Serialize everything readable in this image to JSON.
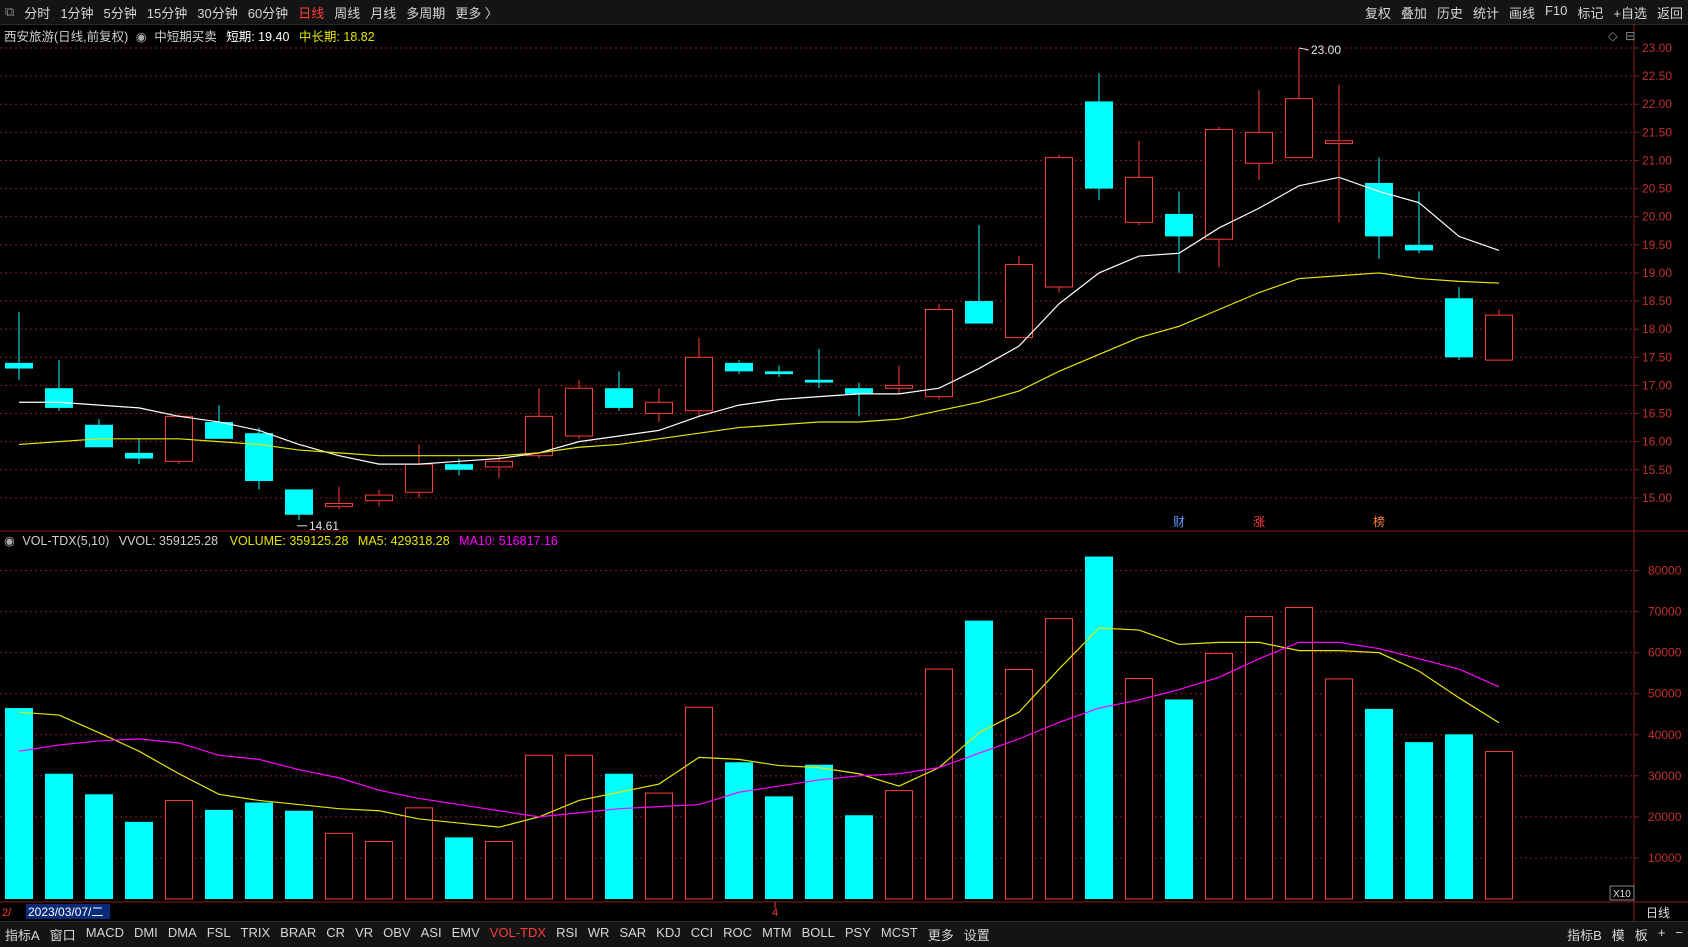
{
  "toolbar": {
    "periods": [
      "分时",
      "1分钟",
      "5分钟",
      "15分钟",
      "30分钟",
      "60分钟",
      "日线",
      "周线",
      "月线",
      "多周期",
      "更多 〉"
    ],
    "active_period": "日线",
    "right_items": [
      "复权",
      "叠加",
      "历史",
      "统计",
      "画线",
      "F10",
      "标记",
      "+自选",
      "返回"
    ]
  },
  "price_panel": {
    "title": "西安旅游(日线,前复权)",
    "indicator_name": "中短期买卖",
    "short_label": "短期: 19.40",
    "long_label": "中长期: 18.82",
    "high_label": "23.00",
    "low_label": "14.61",
    "event_marks": [
      "财",
      "涨",
      "榜"
    ]
  },
  "volume_panel": {
    "title": "VOL-TDX(5,10)",
    "vvol_label": "VVOL: 359125.28",
    "volume_label": "VOLUME: 359125.28",
    "ma5_label": "MA5: 429318.28",
    "ma10_label": "MA10: 516817.16",
    "unit_label": "X10"
  },
  "axis": {
    "date_label": "2023/03/07/二",
    "month_marker": "4",
    "left_marker": "2/"
  },
  "bottom_bar": {
    "left_label": "指标A",
    "tabs": [
      "窗口",
      "MACD",
      "DMI",
      "DMA",
      "FSL",
      "TRIX",
      "BRAR",
      "CR",
      "VR",
      "OBV",
      "ASI",
      "EMV",
      "VOL-TDX",
      "RSI",
      "WR",
      "SAR",
      "KDJ",
      "CCI",
      "ROC",
      "MTM",
      "BOLL",
      "PSY",
      "MCST",
      "更多",
      "设置"
    ],
    "active_tab": "VOL-TDX",
    "right_labels": [
      "指标B",
      "模",
      "板",
      "日线"
    ],
    "zoom_in": "+",
    "zoom_out": "−"
  },
  "colors": {
    "up": "#ff3b3b",
    "down": "#00ffff",
    "short_line": "#ffffff",
    "long_line": "#e6e600",
    "ma5": "#e6e600",
    "ma10": "#ff00ff",
    "grid": "#8b1a1a"
  },
  "chart_data": {
    "type": "candlestick",
    "price_axis": {
      "min": 14.5,
      "max": 23.0,
      "ticks": [
        15.0,
        15.5,
        16.0,
        16.5,
        17.0,
        17.5,
        18.0,
        18.5,
        19.0,
        19.5,
        20.0,
        20.5,
        21.0,
        21.5,
        22.0,
        22.5,
        23.0
      ]
    },
    "volume_axis": {
      "min": 0,
      "max": 85000,
      "ticks": [
        10000,
        20000,
        30000,
        40000,
        50000,
        60000,
        70000,
        80000
      ]
    },
    "candles": [
      {
        "o": 17.4,
        "h": 18.3,
        "l": 17.1,
        "c": 17.3
      },
      {
        "o": 16.95,
        "h": 17.45,
        "l": 16.55,
        "c": 16.6
      },
      {
        "o": 16.3,
        "h": 16.4,
        "l": 15.9,
        "c": 15.9
      },
      {
        "o": 15.8,
        "h": 16.05,
        "l": 15.6,
        "c": 15.7
      },
      {
        "o": 15.65,
        "h": 16.5,
        "l": 15.6,
        "c": 16.45
      },
      {
        "o": 16.35,
        "h": 16.65,
        "l": 16.05,
        "c": 16.05
      },
      {
        "o": 16.15,
        "h": 16.25,
        "l": 15.15,
        "c": 15.3
      },
      {
        "o": 15.15,
        "h": 15.15,
        "l": 14.61,
        "c": 14.7
      },
      {
        "o": 14.85,
        "h": 15.2,
        "l": 14.8,
        "c": 14.9
      },
      {
        "o": 14.95,
        "h": 15.15,
        "l": 14.85,
        "c": 15.05
      },
      {
        "o": 15.1,
        "h": 15.95,
        "l": 15.0,
        "c": 15.6
      },
      {
        "o": 15.6,
        "h": 15.7,
        "l": 15.4,
        "c": 15.5
      },
      {
        "o": 15.55,
        "h": 15.75,
        "l": 15.35,
        "c": 15.65
      },
      {
        "o": 15.75,
        "h": 16.95,
        "l": 15.7,
        "c": 16.45
      },
      {
        "o": 16.1,
        "h": 17.1,
        "l": 16.05,
        "c": 16.95
      },
      {
        "o": 16.95,
        "h": 17.25,
        "l": 16.55,
        "c": 16.6
      },
      {
        "o": 16.5,
        "h": 16.95,
        "l": 16.35,
        "c": 16.7
      },
      {
        "o": 16.55,
        "h": 17.85,
        "l": 16.45,
        "c": 17.5
      },
      {
        "o": 17.4,
        "h": 17.45,
        "l": 17.2,
        "c": 17.25
      },
      {
        "o": 17.25,
        "h": 17.35,
        "l": 17.15,
        "c": 17.2
      },
      {
        "o": 17.1,
        "h": 17.65,
        "l": 16.95,
        "c": 17.05
      },
      {
        "o": 16.95,
        "h": 17.05,
        "l": 16.45,
        "c": 16.85
      },
      {
        "o": 16.95,
        "h": 17.35,
        "l": 16.85,
        "c": 17.0
      },
      {
        "o": 16.8,
        "h": 18.45,
        "l": 16.75,
        "c": 18.35
      },
      {
        "o": 18.5,
        "h": 19.85,
        "l": 18.1,
        "c": 18.1
      },
      {
        "o": 17.85,
        "h": 19.3,
        "l": 17.85,
        "c": 19.15
      },
      {
        "o": 18.75,
        "h": 21.1,
        "l": 18.65,
        "c": 21.05
      },
      {
        "o": 22.05,
        "h": 22.55,
        "l": 20.3,
        "c": 20.5
      },
      {
        "o": 19.9,
        "h": 21.35,
        "l": 19.85,
        "c": 20.7
      },
      {
        "o": 20.05,
        "h": 20.45,
        "l": 19.0,
        "c": 19.65
      },
      {
        "o": 19.6,
        "h": 21.6,
        "l": 19.1,
        "c": 21.55
      },
      {
        "o": 20.95,
        "h": 22.25,
        "l": 20.65,
        "c": 21.5
      },
      {
        "o": 21.05,
        "h": 23.0,
        "l": 21.05,
        "c": 22.1
      },
      {
        "o": 21.3,
        "h": 22.35,
        "l": 19.9,
        "c": 21.35
      },
      {
        "o": 20.6,
        "h": 21.05,
        "l": 19.25,
        "c": 19.65
      },
      {
        "o": 19.5,
        "h": 20.45,
        "l": 19.35,
        "c": 19.4
      },
      {
        "o": 18.55,
        "h": 18.75,
        "l": 17.45,
        "c": 17.5
      },
      {
        "o": 17.45,
        "h": 18.35,
        "l": 17.45,
        "c": 18.25
      }
    ],
    "short_term": [
      16.7,
      16.7,
      16.65,
      16.6,
      16.45,
      16.35,
      16.2,
      15.95,
      15.75,
      15.6,
      15.6,
      15.65,
      15.7,
      15.8,
      16.0,
      16.1,
      16.2,
      16.45,
      16.65,
      16.75,
      16.8,
      16.85,
      16.85,
      16.95,
      17.3,
      17.7,
      18.45,
      19.0,
      19.3,
      19.35,
      19.8,
      20.15,
      20.55,
      20.7,
      20.45,
      20.25,
      19.65,
      19.4
    ],
    "long_term": [
      15.95,
      16.0,
      16.05,
      16.05,
      16.05,
      16.0,
      15.95,
      15.85,
      15.8,
      15.75,
      15.75,
      15.75,
      15.75,
      15.8,
      15.9,
      15.95,
      16.05,
      16.15,
      16.25,
      16.3,
      16.35,
      16.35,
      16.4,
      16.55,
      16.7,
      16.9,
      17.25,
      17.55,
      17.85,
      18.05,
      18.35,
      18.65,
      18.9,
      18.95,
      19.0,
      18.9,
      18.85,
      18.82
    ],
    "volume": [
      46500,
      30500,
      25500,
      18800,
      24000,
      21700,
      23500,
      21500,
      16000,
      14000,
      22200,
      15000,
      14000,
      35000,
      35000,
      30500,
      25800,
      46700,
      33300,
      25000,
      32700,
      20400,
      26400,
      56000,
      67800,
      55900,
      68300,
      83400,
      53700,
      48600,
      59800,
      68800,
      71000,
      53600,
      46300,
      38200,
      40100,
      35912
    ],
    "ma5": [
      45500,
      44800,
      40500,
      36000,
      30500,
      25500,
      24000,
      23000,
      22000,
      21500,
      19500,
      18500,
      17500,
      20000,
      24000,
      26000,
      28000,
      34500,
      34000,
      32500,
      32000,
      30500,
      27500,
      32000,
      40500,
      45500,
      56000,
      66000,
      65500,
      62000,
      62500,
      62500,
      60500,
      60500,
      60000,
      55500,
      49000,
      42932
    ],
    "ma10": [
      36000,
      37500,
      38500,
      39000,
      38000,
      35000,
      34000,
      31500,
      29500,
      26500,
      24500,
      23000,
      21500,
      20000,
      21000,
      22000,
      22500,
      23000,
      26000,
      27500,
      29000,
      30000,
      30500,
      32000,
      35500,
      39000,
      43000,
      46500,
      48500,
      51000,
      54000,
      58500,
      62500,
      62500,
      61000,
      58500,
      56000,
      51682
    ],
    "up_down": [
      "down",
      "down",
      "down",
      "down",
      "up",
      "down",
      "down",
      "down",
      "up",
      "up",
      "up",
      "down",
      "up",
      "up",
      "up",
      "down",
      "up",
      "up",
      "down",
      "down",
      "down",
      "down",
      "up",
      "up",
      "down",
      "up",
      "up",
      "down",
      "up",
      "down",
      "up",
      "up",
      "up",
      "up",
      "down",
      "down",
      "down",
      "up"
    ]
  }
}
